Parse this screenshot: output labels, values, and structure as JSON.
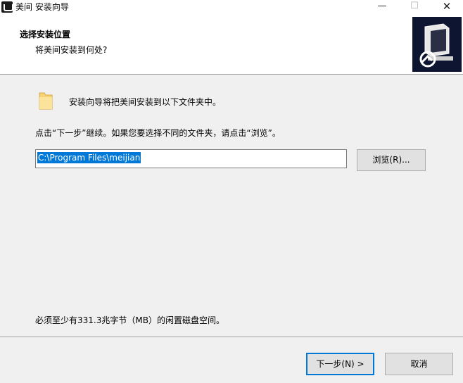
{
  "window": {
    "title": "美间 安装向导",
    "minimize_glyph": "—",
    "maximize_glyph": "☐",
    "close_glyph": "✕"
  },
  "header": {
    "title": "选择安装位置",
    "subtitle": "将美间安装到何处?"
  },
  "body": {
    "install_line": "安装向导将把美间安装到以下文件夹中。",
    "instruction": "点击“下一步”继续。如果您要选择不同的文件夹，请点击“浏览”。",
    "path_value": "C:\\Program Files\\meijian",
    "browse_label": "浏览(R)...",
    "space_text": "必须至少有331.3兆字节（MB）的闲置磁盘空间。"
  },
  "footer": {
    "next_label": "下一步(N) >",
    "cancel_label": "取消"
  },
  "icons": {
    "app": "app-logo-icon",
    "header": "installer-computer-icon",
    "folder": "folder-icon"
  }
}
